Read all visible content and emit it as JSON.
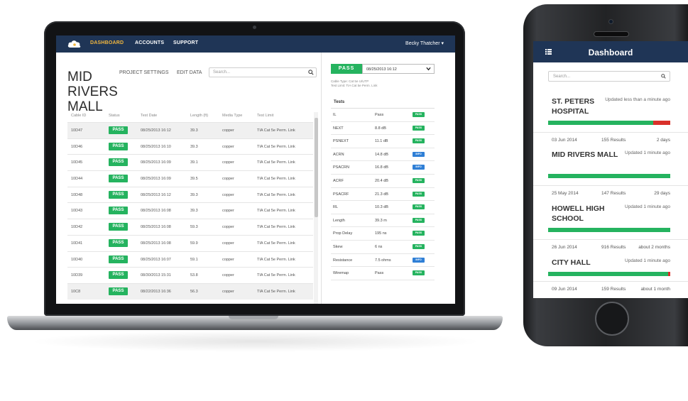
{
  "laptop": {
    "nav": {
      "items": [
        "DASHBOARD",
        "ACCOUNTS",
        "SUPPORT"
      ],
      "active": "DASHBOARD",
      "user": "Becky Thatcher ▾"
    },
    "page": {
      "title_line1": "MID",
      "title_line2": "RIVERS MALL",
      "links": [
        "PROJECT SETTINGS",
        "EDIT DATA"
      ],
      "search_placeholder": "Search..."
    },
    "table": {
      "columns": [
        "Cable ID",
        "Status",
        "Test Date",
        "Length (ft)",
        "Media Type",
        "Test Limit"
      ],
      "rows": [
        {
          "id": "10D47",
          "status": "PASS",
          "date": "08/25/2013 16:12",
          "length": "39.3",
          "media": "copper",
          "limit": "TIA Cat 5e Perm. Link"
        },
        {
          "id": "10D46",
          "status": "PASS",
          "date": "08/25/2013 16:10",
          "length": "39.3",
          "media": "copper",
          "limit": "TIA Cat 5e Perm. Link"
        },
        {
          "id": "10D45",
          "status": "PASS",
          "date": "08/25/2013 16:09",
          "length": "39.1",
          "media": "copper",
          "limit": "TIA Cat 5e Perm. Link"
        },
        {
          "id": "10D44",
          "status": "PASS",
          "date": "08/25/2013 16:09",
          "length": "39.5",
          "media": "copper",
          "limit": "TIA Cat 5e Perm. Link"
        },
        {
          "id": "10D48",
          "status": "PASS",
          "date": "08/25/2013 16:12",
          "length": "39.3",
          "media": "copper",
          "limit": "TIA Cat 5e Perm. Link"
        },
        {
          "id": "10D43",
          "status": "PASS",
          "date": "08/25/2013 16:08",
          "length": "39.3",
          "media": "copper",
          "limit": "TIA Cat 5e Perm. Link"
        },
        {
          "id": "10D42",
          "status": "PASS",
          "date": "08/25/2013 16:08",
          "length": "59.3",
          "media": "copper",
          "limit": "TIA Cat 5e Perm. Link"
        },
        {
          "id": "10D41",
          "status": "PASS",
          "date": "08/25/2013 16:08",
          "length": "59.9",
          "media": "copper",
          "limit": "TIA Cat 5e Perm. Link"
        },
        {
          "id": "10D40",
          "status": "PASS",
          "date": "08/25/2013 16:07",
          "length": "59.1",
          "media": "copper",
          "limit": "TIA Cat 5e Perm. Link"
        },
        {
          "id": "10D39",
          "status": "PASS",
          "date": "08/30/2013 15:31",
          "length": "53.8",
          "media": "copper",
          "limit": "TIA Cat 5e Perm. Link"
        },
        {
          "id": "10C8",
          "status": "PASS",
          "date": "08/22/2013 16:36",
          "length": "56.3",
          "media": "copper",
          "limit": "TIA Cat 5e Perm. Link"
        }
      ]
    },
    "detail": {
      "status": "PASS",
      "date_value": "08/25/2013 16:12",
      "cable_type": "Cable Type: Cat 5e U/UTP",
      "test_limit": "Test Limit: TIA Cat 5e Perm. Link",
      "tests_label": "Tests",
      "tests": [
        {
          "name": "IL",
          "value": "Pass",
          "badge": "PASS"
        },
        {
          "name": "NEXT",
          "value": "8.8 dB",
          "badge": "PASS"
        },
        {
          "name": "PSNEXT",
          "value": "11.1 dB",
          "badge": "PASS"
        },
        {
          "name": "ACRN",
          "value": "14.8 dB",
          "badge": "INFO"
        },
        {
          "name": "PSACRN",
          "value": "16.8 dB",
          "badge": "INFO"
        },
        {
          "name": "ACRF",
          "value": "20.4 dB",
          "badge": "PASS"
        },
        {
          "name": "PSACRF",
          "value": "21.3 dB",
          "badge": "PASS"
        },
        {
          "name": "RL",
          "value": "10.3 dB",
          "badge": "PASS"
        },
        {
          "name": "Length",
          "value": "39.3 m",
          "badge": "PASS"
        },
        {
          "name": "Prop Delay",
          "value": "195 ns",
          "badge": "PASS"
        },
        {
          "name": "Skew",
          "value": "6 ns",
          "badge": "PASS"
        },
        {
          "name": "Resistance",
          "value": "7.5 ohms",
          "badge": "INFO"
        },
        {
          "name": "Wiremap",
          "value": "Pass",
          "badge": "PASS"
        }
      ]
    }
  },
  "phone": {
    "title": "Dashboard",
    "search_placeholder": "Search...",
    "projects": [
      {
        "name": "ST. PETERS HOSPITAL",
        "updated": "Updated less than a minute ago",
        "fail_fraction": 0.14,
        "date": "03 Jun 2014",
        "results": "155 Results",
        "ago": "2 days"
      },
      {
        "name": "MID RIVERS MALL",
        "updated": "Updated 1 minute ago",
        "fail_fraction": 0,
        "date": "25 May 2014",
        "results": "147 Results",
        "ago": "29 days"
      },
      {
        "name": "HOWELL HIGH SCHOOL",
        "updated": "Updated 1 minute ago",
        "fail_fraction": 0,
        "date": "26 Jun 2014",
        "results": "916 Results",
        "ago": "about 2 months"
      },
      {
        "name": "CITY HALL",
        "updated": "Updated 1 minute ago",
        "fail_fraction": 0.02,
        "date": "09 Jun 2014",
        "results": "159 Results",
        "ago": "about 1 month"
      }
    ]
  },
  "colors": {
    "navy": "#1f3556",
    "pass_green": "#25b35f",
    "info_blue": "#2f7fd6",
    "fail_red": "#d9302a",
    "nav_active": "#f0b63f"
  }
}
